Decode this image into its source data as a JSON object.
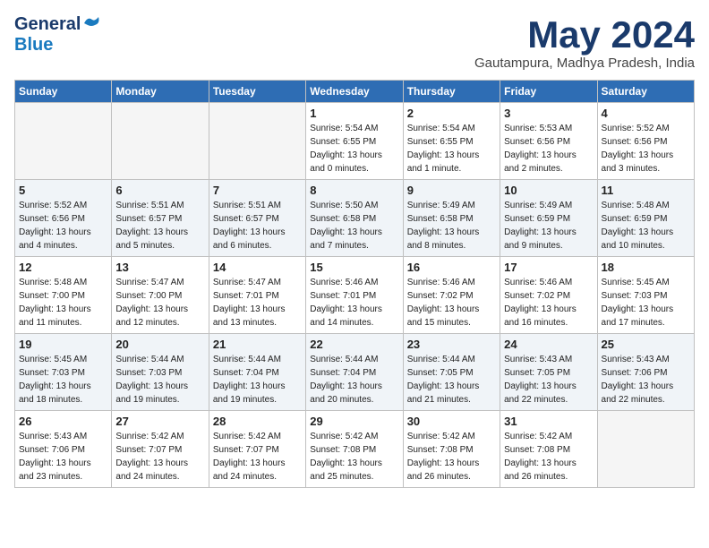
{
  "header": {
    "logo_general": "General",
    "logo_blue": "Blue",
    "month_title": "May 2024",
    "location": "Gautampura, Madhya Pradesh, India"
  },
  "days_of_week": [
    "Sunday",
    "Monday",
    "Tuesday",
    "Wednesday",
    "Thursday",
    "Friday",
    "Saturday"
  ],
  "weeks": [
    [
      {
        "day": "",
        "info": ""
      },
      {
        "day": "",
        "info": ""
      },
      {
        "day": "",
        "info": ""
      },
      {
        "day": "1",
        "info": "Sunrise: 5:54 AM\nSunset: 6:55 PM\nDaylight: 13 hours\nand 0 minutes."
      },
      {
        "day": "2",
        "info": "Sunrise: 5:54 AM\nSunset: 6:55 PM\nDaylight: 13 hours\nand 1 minute."
      },
      {
        "day": "3",
        "info": "Sunrise: 5:53 AM\nSunset: 6:56 PM\nDaylight: 13 hours\nand 2 minutes."
      },
      {
        "day": "4",
        "info": "Sunrise: 5:52 AM\nSunset: 6:56 PM\nDaylight: 13 hours\nand 3 minutes."
      }
    ],
    [
      {
        "day": "5",
        "info": "Sunrise: 5:52 AM\nSunset: 6:56 PM\nDaylight: 13 hours\nand 4 minutes."
      },
      {
        "day": "6",
        "info": "Sunrise: 5:51 AM\nSunset: 6:57 PM\nDaylight: 13 hours\nand 5 minutes."
      },
      {
        "day": "7",
        "info": "Sunrise: 5:51 AM\nSunset: 6:57 PM\nDaylight: 13 hours\nand 6 minutes."
      },
      {
        "day": "8",
        "info": "Sunrise: 5:50 AM\nSunset: 6:58 PM\nDaylight: 13 hours\nand 7 minutes."
      },
      {
        "day": "9",
        "info": "Sunrise: 5:49 AM\nSunset: 6:58 PM\nDaylight: 13 hours\nand 8 minutes."
      },
      {
        "day": "10",
        "info": "Sunrise: 5:49 AM\nSunset: 6:59 PM\nDaylight: 13 hours\nand 9 minutes."
      },
      {
        "day": "11",
        "info": "Sunrise: 5:48 AM\nSunset: 6:59 PM\nDaylight: 13 hours\nand 10 minutes."
      }
    ],
    [
      {
        "day": "12",
        "info": "Sunrise: 5:48 AM\nSunset: 7:00 PM\nDaylight: 13 hours\nand 11 minutes."
      },
      {
        "day": "13",
        "info": "Sunrise: 5:47 AM\nSunset: 7:00 PM\nDaylight: 13 hours\nand 12 minutes."
      },
      {
        "day": "14",
        "info": "Sunrise: 5:47 AM\nSunset: 7:01 PM\nDaylight: 13 hours\nand 13 minutes."
      },
      {
        "day": "15",
        "info": "Sunrise: 5:46 AM\nSunset: 7:01 PM\nDaylight: 13 hours\nand 14 minutes."
      },
      {
        "day": "16",
        "info": "Sunrise: 5:46 AM\nSunset: 7:02 PM\nDaylight: 13 hours\nand 15 minutes."
      },
      {
        "day": "17",
        "info": "Sunrise: 5:46 AM\nSunset: 7:02 PM\nDaylight: 13 hours\nand 16 minutes."
      },
      {
        "day": "18",
        "info": "Sunrise: 5:45 AM\nSunset: 7:03 PM\nDaylight: 13 hours\nand 17 minutes."
      }
    ],
    [
      {
        "day": "19",
        "info": "Sunrise: 5:45 AM\nSunset: 7:03 PM\nDaylight: 13 hours\nand 18 minutes."
      },
      {
        "day": "20",
        "info": "Sunrise: 5:44 AM\nSunset: 7:03 PM\nDaylight: 13 hours\nand 19 minutes."
      },
      {
        "day": "21",
        "info": "Sunrise: 5:44 AM\nSunset: 7:04 PM\nDaylight: 13 hours\nand 19 minutes."
      },
      {
        "day": "22",
        "info": "Sunrise: 5:44 AM\nSunset: 7:04 PM\nDaylight: 13 hours\nand 20 minutes."
      },
      {
        "day": "23",
        "info": "Sunrise: 5:44 AM\nSunset: 7:05 PM\nDaylight: 13 hours\nand 21 minutes."
      },
      {
        "day": "24",
        "info": "Sunrise: 5:43 AM\nSunset: 7:05 PM\nDaylight: 13 hours\nand 22 minutes."
      },
      {
        "day": "25",
        "info": "Sunrise: 5:43 AM\nSunset: 7:06 PM\nDaylight: 13 hours\nand 22 minutes."
      }
    ],
    [
      {
        "day": "26",
        "info": "Sunrise: 5:43 AM\nSunset: 7:06 PM\nDaylight: 13 hours\nand 23 minutes."
      },
      {
        "day": "27",
        "info": "Sunrise: 5:42 AM\nSunset: 7:07 PM\nDaylight: 13 hours\nand 24 minutes."
      },
      {
        "day": "28",
        "info": "Sunrise: 5:42 AM\nSunset: 7:07 PM\nDaylight: 13 hours\nand 24 minutes."
      },
      {
        "day": "29",
        "info": "Sunrise: 5:42 AM\nSunset: 7:08 PM\nDaylight: 13 hours\nand 25 minutes."
      },
      {
        "day": "30",
        "info": "Sunrise: 5:42 AM\nSunset: 7:08 PM\nDaylight: 13 hours\nand 26 minutes."
      },
      {
        "day": "31",
        "info": "Sunrise: 5:42 AM\nSunset: 7:08 PM\nDaylight: 13 hours\nand 26 minutes."
      },
      {
        "day": "",
        "info": ""
      }
    ]
  ]
}
